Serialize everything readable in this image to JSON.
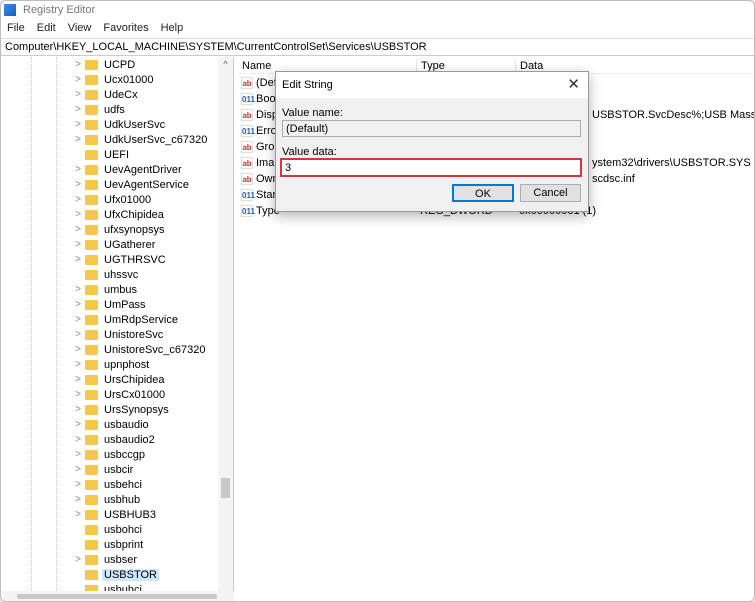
{
  "window": {
    "title": "Registry Editor"
  },
  "menu": [
    "File",
    "Edit",
    "View",
    "Favorites",
    "Help"
  ],
  "address": "Computer\\HKEY_LOCAL_MACHINE\\SYSTEM\\CurrentControlSet\\Services\\USBSTOR",
  "tree": {
    "items": [
      {
        "label": "UCPD",
        "expandable": true
      },
      {
        "label": "Ucx01000",
        "expandable": true
      },
      {
        "label": "UdeCx",
        "expandable": true
      },
      {
        "label": "udfs",
        "expandable": true
      },
      {
        "label": "UdkUserSvc",
        "expandable": true
      },
      {
        "label": "UdkUserSvc_c67320",
        "expandable": true
      },
      {
        "label": "UEFI",
        "expandable": false
      },
      {
        "label": "UevAgentDriver",
        "expandable": true
      },
      {
        "label": "UevAgentService",
        "expandable": true
      },
      {
        "label": "Ufx01000",
        "expandable": true
      },
      {
        "label": "UfxChipidea",
        "expandable": true
      },
      {
        "label": "ufxsynopsys",
        "expandable": true
      },
      {
        "label": "UGatherer",
        "expandable": true
      },
      {
        "label": "UGTHRSVC",
        "expandable": true
      },
      {
        "label": "uhssvc",
        "expandable": false
      },
      {
        "label": "umbus",
        "expandable": true
      },
      {
        "label": "UmPass",
        "expandable": true
      },
      {
        "label": "UmRdpService",
        "expandable": true
      },
      {
        "label": "UnistoreSvc",
        "expandable": true
      },
      {
        "label": "UnistoreSvc_c67320",
        "expandable": true
      },
      {
        "label": "upnphost",
        "expandable": true
      },
      {
        "label": "UrsChipidea",
        "expandable": true
      },
      {
        "label": "UrsCx01000",
        "expandable": true
      },
      {
        "label": "UrsSynopsys",
        "expandable": true
      },
      {
        "label": "usbaudio",
        "expandable": true
      },
      {
        "label": "usbaudio2",
        "expandable": true
      },
      {
        "label": "usbccgp",
        "expandable": true
      },
      {
        "label": "usbcir",
        "expandable": true
      },
      {
        "label": "usbehci",
        "expandable": true
      },
      {
        "label": "usbhub",
        "expandable": true
      },
      {
        "label": "USBHUB3",
        "expandable": true
      },
      {
        "label": "usbohci",
        "expandable": false
      },
      {
        "label": "usbprint",
        "expandable": false
      },
      {
        "label": "usbser",
        "expandable": true
      },
      {
        "label": "USBSTOR",
        "expandable": false,
        "selected": true
      },
      {
        "label": "usbuhci",
        "expandable": false
      }
    ]
  },
  "list": {
    "columns": [
      "Name",
      "Type",
      "Data"
    ],
    "rows": [
      {
        "icon": "string",
        "name": "(Default)",
        "type": "",
        "data": ""
      },
      {
        "icon": "binary",
        "name": "Boot",
        "type": "",
        "data": ""
      },
      {
        "icon": "string",
        "name": "Disp",
        "type": "",
        "data": "USBSTOR.SvcDesc%;USB Mass Stor..."
      },
      {
        "icon": "binary",
        "name": "Erro",
        "type": "",
        "data": ""
      },
      {
        "icon": "string",
        "name": "Grou",
        "type": "",
        "data": ""
      },
      {
        "icon": "string",
        "name": "Ima",
        "type": "",
        "data": "ystem32\\drivers\\USBSTOR.SYS"
      },
      {
        "icon": "string",
        "name": "Own",
        "type": "",
        "data": "scdsc.inf"
      },
      {
        "icon": "binary",
        "name": "Star",
        "type": "",
        "data": ""
      },
      {
        "icon": "binary",
        "name": "Type",
        "type": "REG_DWORD",
        "data": "0x00000001 (1)"
      }
    ]
  },
  "dialog": {
    "title": "Edit String",
    "value_name_label": "Value name:",
    "value_name": "(Default)",
    "value_data_label": "Value data:",
    "value_data": "3",
    "ok": "OK",
    "cancel": "Cancel",
    "highlight_color": "#d0383e"
  }
}
